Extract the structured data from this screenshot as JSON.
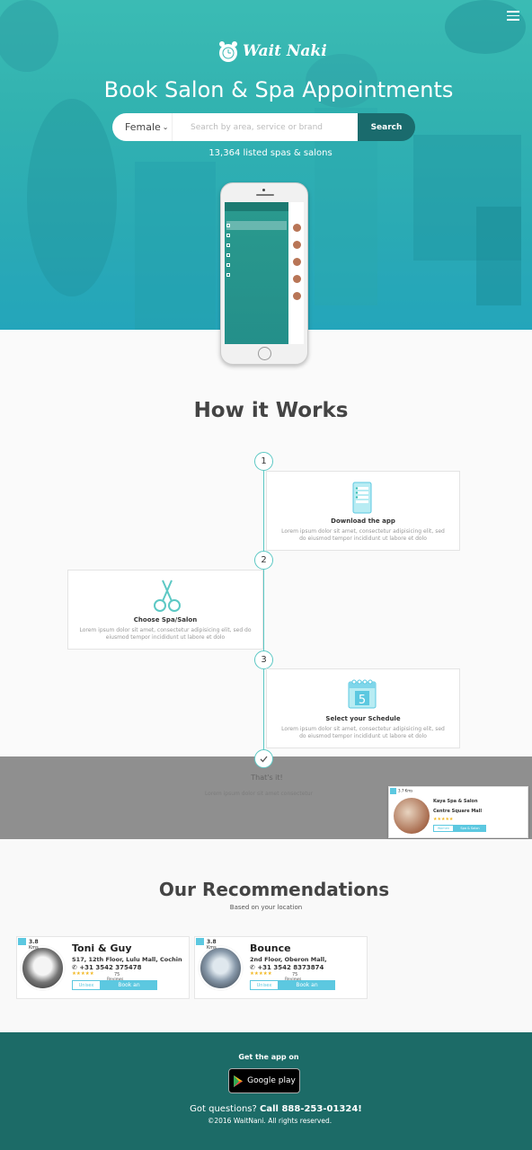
{
  "header": {
    "brand": "Wait Naki",
    "title": "Book Salon & Spa Appointments",
    "listed_count": "13,364 listed spas & salons"
  },
  "search": {
    "gender": "Female",
    "placeholder": "Search by area, service or brand",
    "button": "Search"
  },
  "how_it_works": {
    "title": "How it Works",
    "steps": [
      {
        "num": "1",
        "title": "Download the app",
        "desc": "Lorem ipsum dolor sit amet, consectetur adipisicing elit, sed do eiusmod tempor incididunt ut labore et dolo"
      },
      {
        "num": "2",
        "title": "Choose Spa/Salon",
        "desc": "Lorem ipsum dolor sit amet, consectetur adipisicing elit, sed do eiusmod tempor incididunt ut labore et dolo"
      },
      {
        "num": "3",
        "title": "Select your Schedule",
        "desc": "Lorem ipsum dolor sit amet, consectetur adipisicing elit, sed do eiusmod tempor incididunt ut labore et dolo"
      }
    ],
    "done": "That's it!",
    "done_sub": "Lorem ipsum dolor sit amet consectetur"
  },
  "popup": {
    "rating": "3.7 Kms",
    "name": "Kaya Spa & Salon",
    "location": "Centre Square Mall",
    "stars": "★★★★★",
    "tag": "Women",
    "book": "Spa & Salon"
  },
  "recommendations": {
    "title": "Our Recommendations",
    "subtitle": "Based on your location",
    "items": [
      {
        "distance": "3.8",
        "unit": "Kms",
        "name": "Toni & Guy",
        "address": "S17, 12th Floor, Lulu Mall, Cochin",
        "phone": "+31 3542 375478",
        "stars": "★★★★★",
        "reviews": "75",
        "reviews_label": "Reviews",
        "tag": "Unisex",
        "book": "Book an"
      },
      {
        "distance": "3.8",
        "unit": "Kms",
        "name": "Bounce",
        "address": "2nd Floor, Oberon Mall,",
        "phone": "+31 3542 8373874",
        "stars": "★★★★★",
        "reviews": "75",
        "reviews_label": "Reviews",
        "tag": "Unisex",
        "book": "Book an"
      }
    ]
  },
  "footer": {
    "get_app": "Get the app on",
    "store": "Google play",
    "questions_prefix": "Got questions?",
    "questions_call": "Call 888-253-01324!",
    "copyright": "©2016 WaitNani. All rights reserved."
  },
  "colors": {
    "teal_hero": "#33b3b0",
    "accent": "#5cc8e0",
    "search_button": "#1a6b6d",
    "footer": "#1c6b67"
  }
}
